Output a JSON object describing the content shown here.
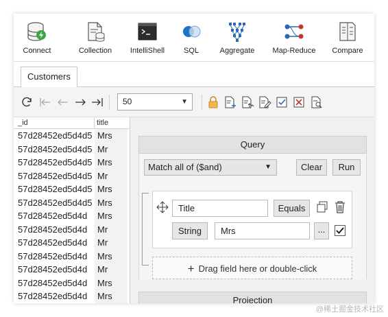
{
  "ribbon": [
    {
      "label": "Connect",
      "icon": "database-connect-icon"
    },
    {
      "label": "Collection",
      "icon": "collection-icon"
    },
    {
      "label": "IntelliShell",
      "icon": "shell-icon"
    },
    {
      "label": "SQL",
      "icon": "sql-icon"
    },
    {
      "label": "Aggregate",
      "icon": "aggregate-icon"
    },
    {
      "label": "Map-Reduce",
      "icon": "map-reduce-icon"
    },
    {
      "label": "Compare",
      "icon": "compare-icon"
    }
  ],
  "tab": {
    "label": "Customers"
  },
  "toolbar": {
    "page_size": "50",
    "icons": [
      "refresh-icon",
      "first-page-icon",
      "previous-page-icon",
      "next-page-icon",
      "last-page-icon",
      "lock-icon",
      "add-document-icon",
      "clone-document-icon",
      "edit-document-icon",
      "validate-icon",
      "delete-document-icon",
      "view-document-icon"
    ]
  },
  "grid": {
    "columns": [
      "_id",
      "title"
    ],
    "rows": [
      {
        "id": "57d28452ed5d4d5",
        "title": "Mrs"
      },
      {
        "id": "57d28452ed5d4d5",
        "title": "Mr"
      },
      {
        "id": "57d28452ed5d4d5",
        "title": "Mrs"
      },
      {
        "id": "57d28452ed5d4d5",
        "title": "Mr"
      },
      {
        "id": "57d28452ed5d4d5",
        "title": "Mrs"
      },
      {
        "id": "57d28452ed5d4d5",
        "title": "Mrs"
      },
      {
        "id": "57d28452ed5d4d",
        "title": "Mrs"
      },
      {
        "id": "57d28452ed5d4d",
        "title": "Mr"
      },
      {
        "id": "57d28452ed5d4d",
        "title": "Mr"
      },
      {
        "id": "57d28452ed5d4d",
        "title": "Mrs"
      },
      {
        "id": "57d28452ed5d4d",
        "title": "Mr"
      },
      {
        "id": "57d28452ed5d4d",
        "title": "Mrs"
      },
      {
        "id": "57d28452ed5d4d",
        "title": "Mrs"
      }
    ]
  },
  "query": {
    "header": "Query",
    "match_select": "Match all of ($and)",
    "clear_label": "Clear",
    "run_label": "Run",
    "field_value": "Title",
    "operator_label": "Equals",
    "type_label": "String",
    "value": "Mrs",
    "ellipsis_label": "...",
    "checkbox_checked": true,
    "dropzone_text": "Drag field here or double-click"
  },
  "projection": {
    "header": "Projection"
  },
  "watermark": "@稀土掘金技术社区"
}
